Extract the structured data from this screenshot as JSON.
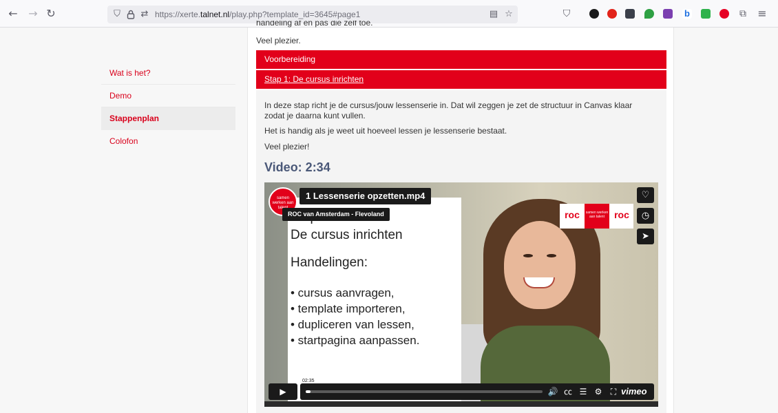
{
  "browser": {
    "url_prefix": "https://xerte.",
    "url_host": "talnet.nl",
    "url_path": "/play.php?template_id=3645#page1",
    "icons": {
      "back": "←",
      "forward": "→",
      "reload": "↻",
      "shield": "⛉",
      "lock": "🔒",
      "permissions": "⇄",
      "reader": "▤",
      "bookmark": "☆",
      "pocket": "⛉",
      "extensions": "⧉",
      "menu": "≡"
    }
  },
  "sidebar": {
    "items": [
      {
        "label": "Wat is het?"
      },
      {
        "label": "Demo"
      },
      {
        "label": "Stappenplan"
      },
      {
        "label": "Colofon"
      }
    ]
  },
  "content": {
    "cut_text": "handeling af en pas die zelf toe.",
    "veel_plezier_top": "Veel plezier.",
    "accordion_1": "Voorbereiding",
    "accordion_2": "Stap 1: De cursus inrichten",
    "para_1": "In deze stap richt je de cursus/jouw lessenserie in. Dat wil zeggen je zet de structuur in Canvas klaar zodat je daarna kunt vullen.",
    "para_2": "Het is handig als je weet uit hoeveel lessen je lessenserie bestaat.",
    "para_3": "Veel plezier!",
    "video_heading": "Video: 2:34"
  },
  "video": {
    "title": "1 Lessenserie opzetten.mp4",
    "channel": "ROC van Amsterdam - Flevoland",
    "badge_text": "samen werken aan talent",
    "slide_title_1": "Stap 1:",
    "slide_title_2": "De cursus inrichten",
    "slide_sub": "Handelingen:",
    "bullets": [
      "• cursus aanvragen,",
      "• template importeren,",
      "• dupliceren van lessen,",
      "• startpagina aanpassen."
    ],
    "logo_left": "rοc",
    "logo_mid": "samen werken aan talent",
    "logo_right": "rοc",
    "time_tooltip": "02:35",
    "progress_fraction": 0.02,
    "brand": "vimeo",
    "icons": {
      "heart": "♡",
      "clock": "◷",
      "send": "➤",
      "play": "▶",
      "volume": "🔊",
      "cc": "㏄",
      "queue": "☰",
      "settings": "⚙",
      "fullscreen": "⛶"
    }
  }
}
